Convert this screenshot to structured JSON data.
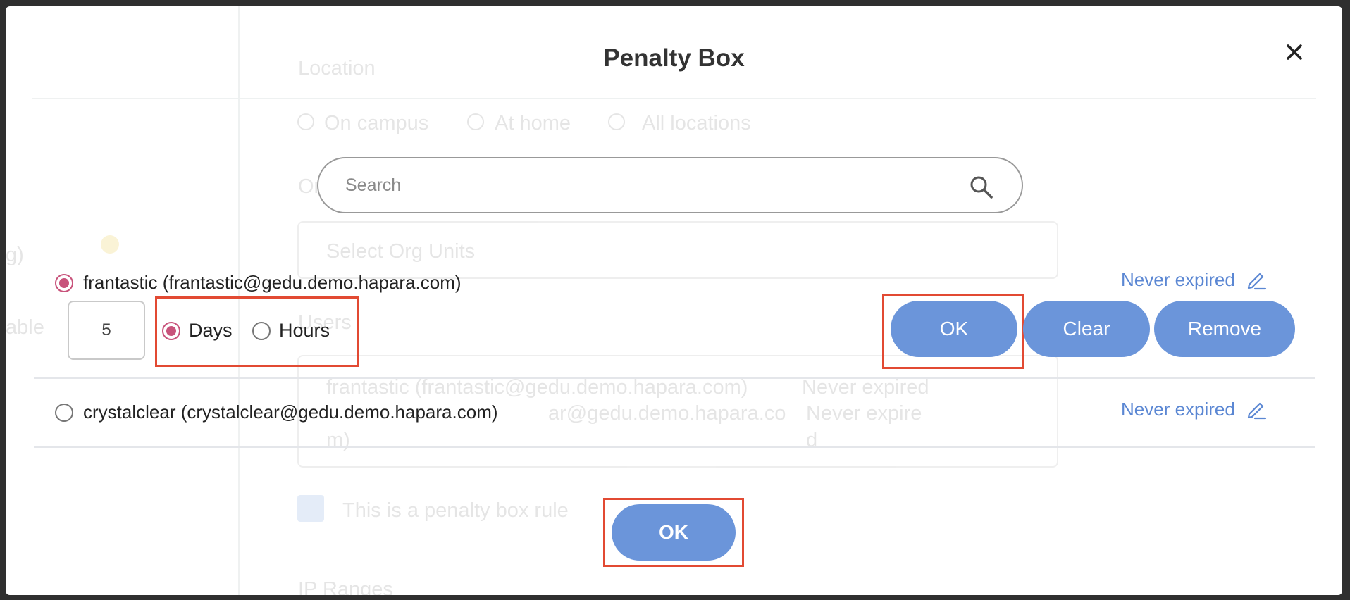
{
  "dialog": {
    "title": "Penalty Box",
    "close_icon": "close-icon"
  },
  "search": {
    "placeholder": "Search",
    "icon": "search-icon"
  },
  "users": [
    {
      "label": "frantastic (frantastic@gedu.demo.hapara.com)",
      "selected": true,
      "expiry": "Never expired",
      "edit_icon": "pencil-icon"
    },
    {
      "label": "crystalclear (crystalclear@gedu.demo.hapara.com)",
      "selected": false,
      "expiry": "Never expired",
      "edit_icon": "pencil-icon"
    }
  ],
  "duration_editor": {
    "value": "5",
    "unit_options": [
      {
        "label": "Days",
        "selected": true
      },
      {
        "label": "Hours",
        "selected": false
      }
    ],
    "ok_label": "OK",
    "clear_label": "Clear",
    "remove_label": "Remove"
  },
  "footer": {
    "ok_label": "OK"
  },
  "background_page": {
    "location_heading": "Location",
    "location_options": [
      "On campus",
      "At home",
      "All locations"
    ],
    "org_units_heading": "Org Units",
    "org_units_placeholder": "Select Org Units",
    "users_heading": "Users",
    "users_lines": [
      "frantastic (frantastic@gedu.demo.hapara.com)",
      "ar@gedu.demo.hapara.co",
      "m)"
    ],
    "expiry_lines": [
      "Never expired",
      "Never expire",
      "d"
    ],
    "penalty_rule_label": "This is a penalty box rule",
    "ip_ranges_heading": "IP Ranges",
    "left_fragments": [
      "g)",
      "able"
    ]
  },
  "colors": {
    "accent": "#6b95da",
    "link": "#5b87d3",
    "radio_selected": "#c8537b",
    "highlight": "#e24a33"
  }
}
